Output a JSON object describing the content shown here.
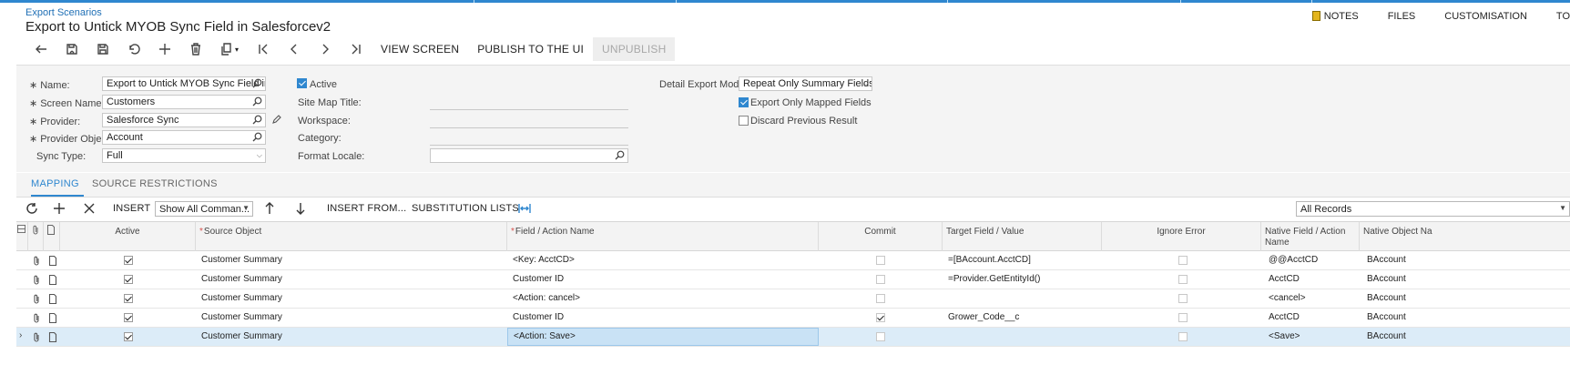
{
  "breadcrumb": "Export Scenarios",
  "title": "Export to Untick MYOB Sync Field in Salesforcev2",
  "right_links": {
    "notes": "NOTES",
    "files": "FILES",
    "customisation": "CUSTOMISATION",
    "tools": "TO"
  },
  "toolbar": {
    "view_screen": "VIEW SCREEN",
    "publish": "PUBLISH TO THE UI",
    "unpublish": "UNPUBLISH"
  },
  "form": {
    "name_label": "Name:",
    "name_value": "Export to Untick MYOB Sync Field in Sal",
    "screen_label": "Screen Name:",
    "screen_value": "Customers",
    "provider_label": "Provider:",
    "provider_value": "Salesforce Sync",
    "provider_object_label": "Provider Object:",
    "provider_object_value": "Account",
    "sync_type_label": "Sync Type:",
    "sync_type_value": "Full",
    "active_label": "Active",
    "active_checked": true,
    "site_map_label": "Site Map Title:",
    "workspace_label": "Workspace:",
    "category_label": "Category:",
    "format_locale_label": "Format Locale:",
    "detail_mode_label": "Detail Export Mode:",
    "detail_mode_value": "Repeat Only Summary Fields",
    "export_mapped_label": "Export Only Mapped Fields",
    "export_mapped_checked": true,
    "discard_label": "Discard Previous Result",
    "discard_checked": false
  },
  "tabs": {
    "mapping": "MAPPING",
    "source_restrictions": "SOURCE RESTRICTIONS"
  },
  "grid_toolbar": {
    "insert": "INSERT",
    "show_commands": "Show All Comman...",
    "insert_from": "INSERT FROM...",
    "substitution_lists": "SUBSTITUTION LISTS",
    "records_filter": "All Records"
  },
  "columns": {
    "active": "Active",
    "source_object": "Source Object",
    "field_action": "Field / Action Name",
    "commit": "Commit",
    "target_field": "Target Field / Value",
    "ignore_error": "Ignore Error",
    "native_field": "Native Field / Action Name",
    "native_object": "Native Object Na"
  },
  "rows": [
    {
      "active": true,
      "source": "Customer Summary",
      "field": "<Key: AcctCD>",
      "commit": false,
      "target": "=[BAccount.AcctCD]",
      "ignore": false,
      "native_field": "@@AcctCD",
      "native_object": "BAccount"
    },
    {
      "active": true,
      "source": "Customer Summary",
      "field": "Customer ID",
      "commit": false,
      "target": "=Provider.GetEntityId()",
      "ignore": false,
      "native_field": "AcctCD",
      "native_object": "BAccount"
    },
    {
      "active": true,
      "source": "Customer Summary",
      "field": "<Action: cancel>",
      "commit": false,
      "target": "",
      "ignore": false,
      "native_field": "<cancel>",
      "native_object": "BAccount"
    },
    {
      "active": true,
      "source": "Customer Summary",
      "field": "Customer ID",
      "commit": true,
      "target": "Grower_Code__c",
      "ignore": false,
      "native_field": "AcctCD",
      "native_object": "BAccount"
    },
    {
      "active": true,
      "source": "Customer Summary",
      "field": "<Action: Save>",
      "commit": false,
      "target": "",
      "ignore": false,
      "native_field": "<Save>",
      "native_object": "BAccount"
    }
  ]
}
